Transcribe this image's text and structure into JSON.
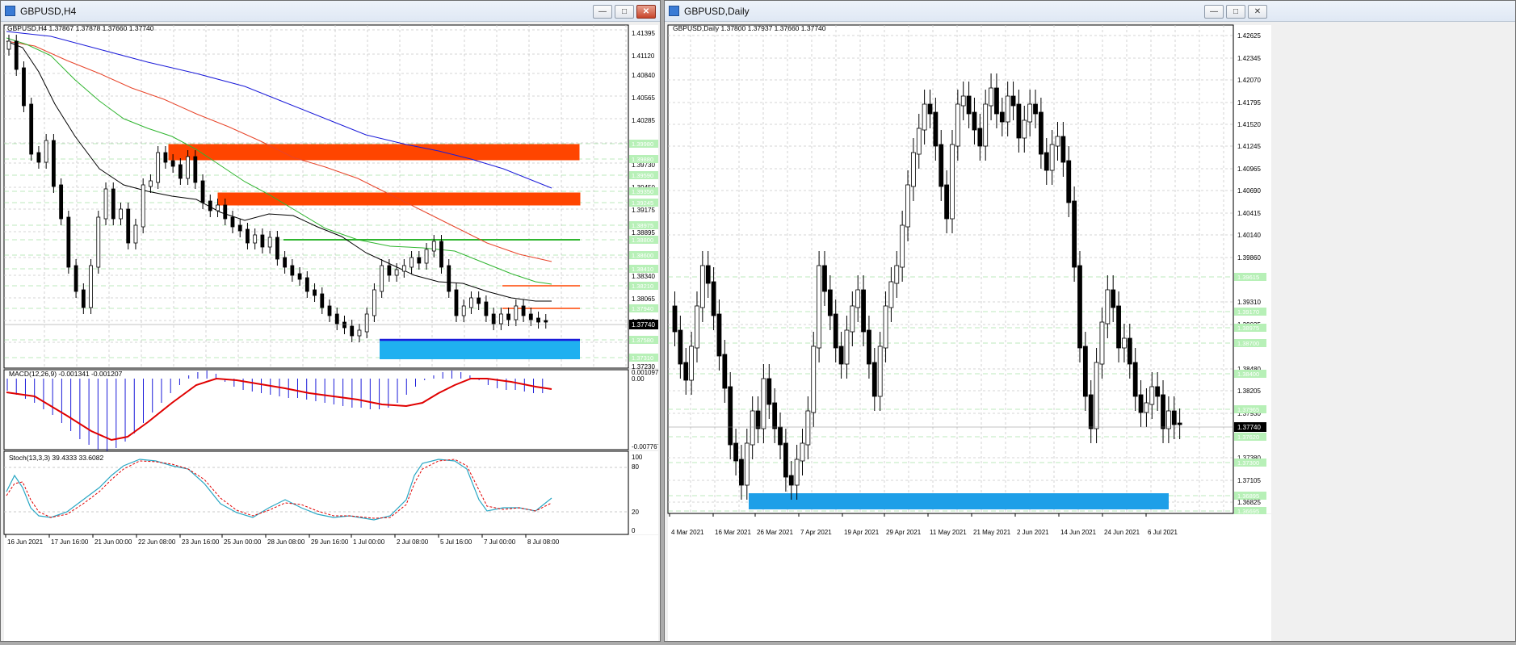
{
  "left": {
    "title": "GBPUSD,H4",
    "chart_header": "GBPUSD,H4  1.37867 1.37878 1.37660 1.37740",
    "y_labels": [
      "1.41395",
      "1.41120",
      "1.40840",
      "1.40565",
      "1.40285",
      "1.39730",
      "1.39450",
      "1.39175",
      "1.38895",
      "1.38340",
      "1.38065",
      "1.37785",
      "1.37230"
    ],
    "level_labels": [
      "1.39980",
      "1.39880",
      "1.39590",
      "1.39350",
      "1.39245",
      "1.38975",
      "1.38800",
      "1.38600",
      "1.38410",
      "1.38210",
      "1.37940",
      "1.37580",
      "1.37310"
    ],
    "current_price": "1.37740",
    "x_labels": [
      "16 Jun 2021",
      "17 Jun 16:00",
      "21 Jun 00:00",
      "22 Jun 08:00",
      "23 Jun 16:00",
      "25 Jun 00:00",
      "28 Jun 08:00",
      "29 Jun 16:00",
      "1 Jul 00:00",
      "2 Jul 08:00",
      "5 Jul 16:00",
      "7 Jul 00:00",
      "8 Jul 08:00"
    ],
    "macd_header": "MACD(12,26,9) -0.001341 -0.001207",
    "macd_labels": [
      "0.001097",
      "0.00",
      "-0.007767"
    ],
    "stoch_header": "Stoch(13,3,3) 39.4333 33.6082",
    "stoch_labels": [
      "100",
      "80",
      "20",
      "0"
    ]
  },
  "right": {
    "title": "GBPUSD,Daily",
    "chart_header": "GBPUSD,Daily  1.37800 1.37937 1.37660 1.37740",
    "y_labels": [
      "1.42625",
      "1.42345",
      "1.42070",
      "1.41795",
      "1.41520",
      "1.41245",
      "1.40965",
      "1.40690",
      "1.40415",
      "1.40140",
      "1.39860",
      "1.39310",
      "1.39035",
      "1.38480",
      "1.38205",
      "1.37930",
      "1.37380",
      "1.37105",
      "1.36825",
      "1.36550"
    ],
    "level_labels": [
      "1.39615",
      "1.39170",
      "1.38975",
      "1.38700",
      "1.38400",
      "1.37965",
      "1.37620",
      "1.37300",
      "1.36895",
      "1.36695"
    ],
    "current_price": "1.37740",
    "x_labels": [
      "4 Mar 2021",
      "16 Mar 2021",
      "26 Mar 2021",
      "7 Apr 2021",
      "19 Apr 2021",
      "29 Apr 2021",
      "11 May 2021",
      "21 May 2021",
      "2 Jun 2021",
      "14 Jun 2021",
      "24 Jun 2021",
      "6 Jul 2021"
    ]
  },
  "colors": {
    "zone_orange": "#ff4500",
    "zone_blue": "#1e9fe8",
    "ma_blue": "#1b1bd9",
    "ma_red": "#e8452a",
    "ma_green": "#2fb52f",
    "signal_red": "#e00000",
    "stoch_main": "#2aa7c4"
  }
}
